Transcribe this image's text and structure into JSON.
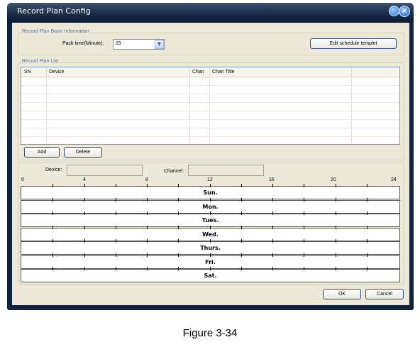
{
  "window": {
    "title": "Record Plan Config"
  },
  "basic_info": {
    "group_label": "Record Plan Basic Information",
    "pack_time_label": "Pack time(Minute):",
    "pack_time_value": "15",
    "edit_button": "Edit schedule templet"
  },
  "plan_list": {
    "group_label": "Record Plan List",
    "columns": [
      "SN",
      "Device",
      "Chan",
      "Chan Title"
    ],
    "add_button": "Add",
    "delete_button": "Delete"
  },
  "schedule": {
    "device_label": "Device:",
    "device_value": "",
    "channel_label": "Channel:",
    "channel_value": "",
    "hour_labels": [
      "0",
      "4",
      "8",
      "12",
      "16",
      "20",
      "24"
    ],
    "days": [
      "Sun.",
      "Mon.",
      "Tues.",
      "Wed.",
      "Thurs.",
      "Fri.",
      "Sat."
    ]
  },
  "footer": {
    "ok_button": "OK",
    "cancel_button": "Cancel"
  },
  "caption": "Figure 3-34"
}
